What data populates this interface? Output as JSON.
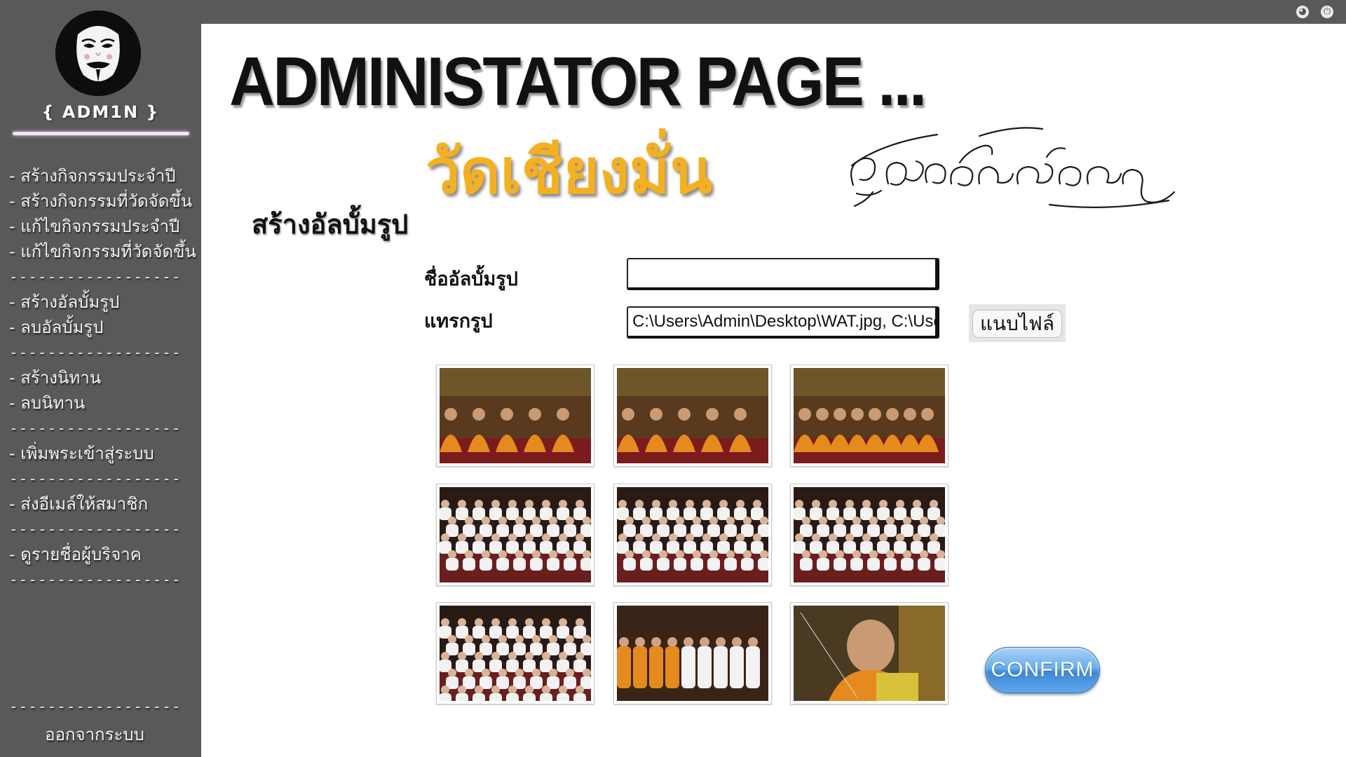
{
  "topbar": {
    "icons": [
      {
        "name": "globe-icon",
        "glyph": "◕"
      },
      {
        "name": "power-icon",
        "glyph": "⏻"
      }
    ]
  },
  "sidebar": {
    "admin_title": "{ ADM1N }",
    "menu": [
      {
        "type": "item",
        "label": "- สร้างกิจกรรมประจำปี"
      },
      {
        "type": "item",
        "label": "- สร้างกิจกรรมที่วัดจัดขึ้น"
      },
      {
        "type": "item",
        "label": "- แก้ไขกิจกรรมประจำปี"
      },
      {
        "type": "item",
        "label": "- แก้ไขกิจกรรมที่วัดจัดขึ้น"
      },
      {
        "type": "sep",
        "label": "------------------"
      },
      {
        "type": "item",
        "label": "- สร้างอัลบั้มรูป"
      },
      {
        "type": "item",
        "label": "- ลบอัลบั้มรูป"
      },
      {
        "type": "sep",
        "label": "------------------"
      },
      {
        "type": "item",
        "label": "- สร้างนิทาน"
      },
      {
        "type": "item",
        "label": "- ลบนิทาน"
      },
      {
        "type": "sep",
        "label": "------------------"
      },
      {
        "type": "item",
        "label": "- เพิ่มพระเข้าสู่ระบบ"
      },
      {
        "type": "sep",
        "label": "------------------"
      },
      {
        "type": "item",
        "label": "- ส่งอีเมล์ให้สมาชิก"
      },
      {
        "type": "sep",
        "label": "------------------"
      },
      {
        "type": "item",
        "label": "- ดูรายชื่อผู้บริจาค"
      },
      {
        "type": "sep",
        "label": "------------------"
      }
    ],
    "bottom_separator": "------------------",
    "logout_label": "ออกจากระบบ"
  },
  "header": {
    "title": "ADMINISTATOR PAGE ...",
    "temple_name": "วัดเชียงมั่น"
  },
  "form": {
    "section_title": "สร้างอัลบั้มรูป",
    "album_name_label": "ชื่ออัลบั้มรูป",
    "album_name_value": "",
    "insert_image_label": "แทรกรูป",
    "file_path_value": "C:\\Users\\Admin\\Desktop\\WAT.jpg, C:\\Users\\Admin\\Desktop",
    "attach_button_label": "แนบไฟล์",
    "confirm_label": "CONFIRM"
  },
  "gallery": {
    "thumbnails": [
      {
        "name": "thumb-monks-ceremony-1",
        "scene": "monks-ceremony"
      },
      {
        "name": "thumb-monks-ceremony-2",
        "scene": "monks-group"
      },
      {
        "name": "thumb-monks-seated-rows",
        "scene": "monks-rows"
      },
      {
        "name": "thumb-white-robed-crowd-1",
        "scene": "white-crowd"
      },
      {
        "name": "thumb-white-robed-crowd-2",
        "scene": "white-crowd"
      },
      {
        "name": "thumb-white-robed-crowd-3",
        "scene": "white-crowd"
      },
      {
        "name": "thumb-white-robed-crowd-4",
        "scene": "white-crowd-dense"
      },
      {
        "name": "thumb-monks-and-laypeople",
        "scene": "mixed"
      },
      {
        "name": "thumb-senior-monk-portrait",
        "scene": "portrait"
      }
    ]
  },
  "colors": {
    "sidebar_bg": "#595959",
    "temple_name": "#f4b020",
    "confirm_blue": "#5fa7ec",
    "monk_robe": "#e58a1f"
  }
}
